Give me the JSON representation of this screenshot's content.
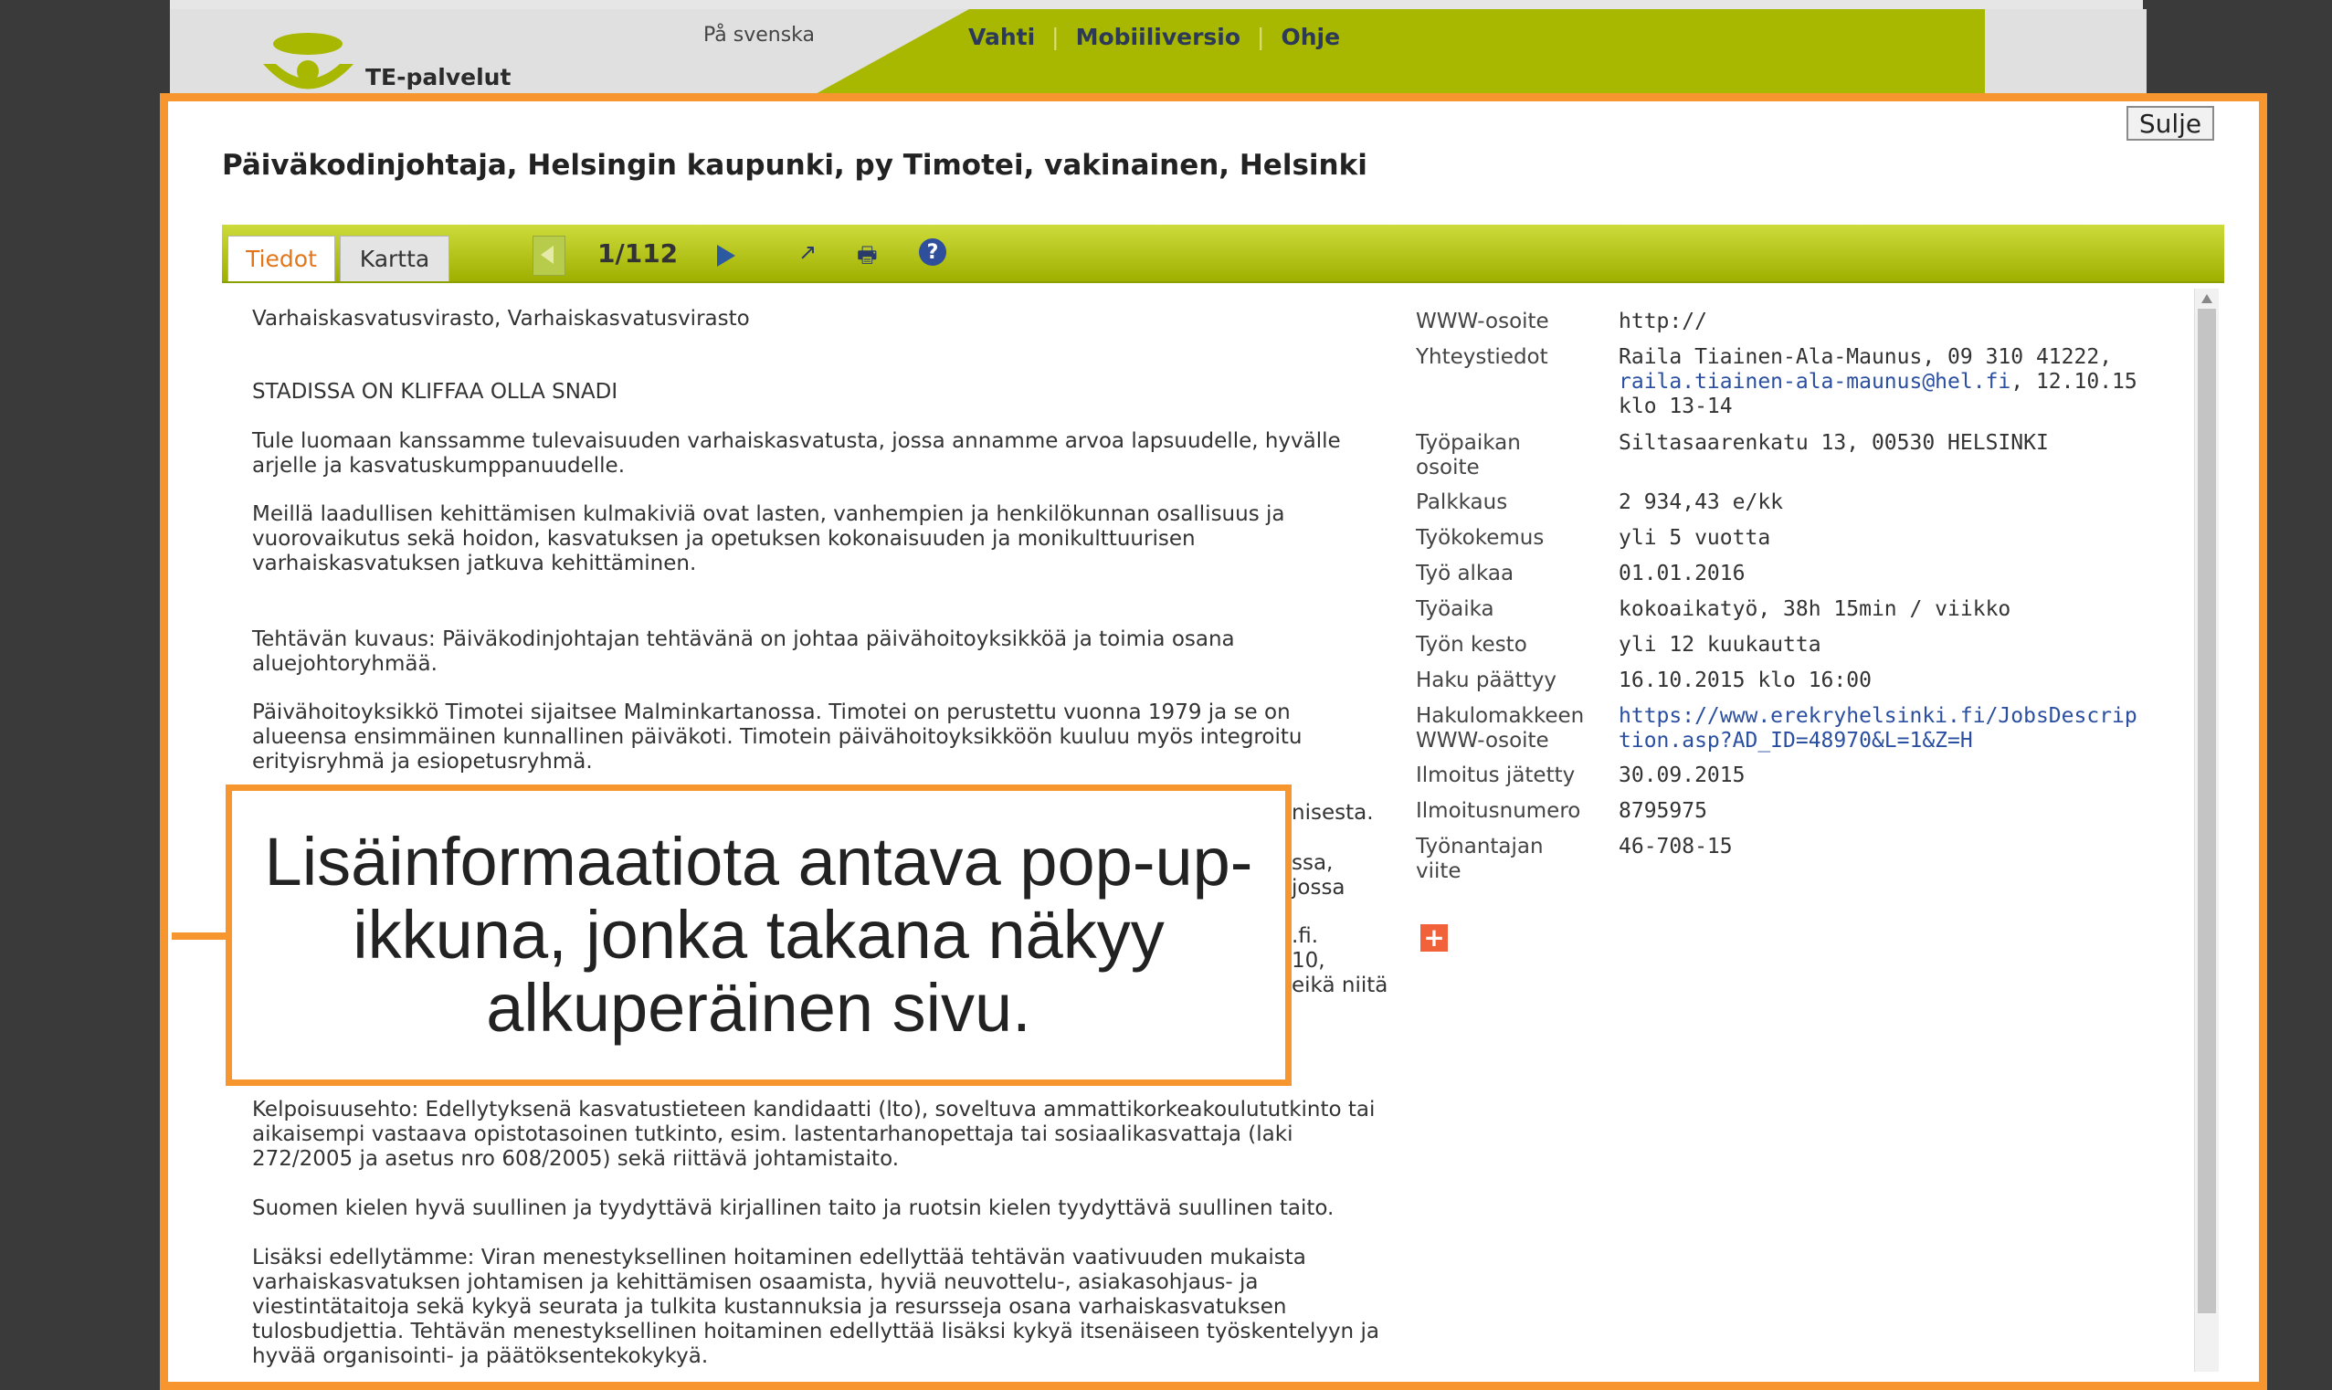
{
  "header": {
    "lang_link": "På svenska",
    "nav": [
      "Vahti",
      "Mobiiliversio",
      "Ohje"
    ],
    "logo_text": "TE-palvelut"
  },
  "popup": {
    "close_label": "Sulje",
    "title": "Päiväkodinjohtaja, Helsingin kaupunki, py Timotei, vakinainen, Helsinki",
    "tabs": [
      "Tiedot",
      "Kartta"
    ],
    "counter": "1/112"
  },
  "content": {
    "employer": "Varhaiskasvatusvirasto, Varhaiskasvatusvirasto",
    "headline": "STADISSA ON KLIFFAA OLLA SNADI",
    "p1": "Tule luomaan kanssamme tulevaisuuden varhaiskasvatusta, jossa annamme arvoa lapsuudelle, hyvälle arjelle ja kasvatuskumppanuudelle.",
    "p2": "Meillä laadullisen kehittämisen kulmakiviä ovat lasten, vanhempien ja henkilökunnan osallisuus ja vuorovaikutus sekä hoidon, kasvatuksen ja opetuksen kokonaisuuden ja monikulttuurisen varhaiskasvatuksen jatkuva kehittäminen.",
    "p3": "Tehtävän kuvaus: Päiväkodinjohtajan tehtävänä on johtaa päivähoitoyksikköä ja toimia osana aluejohtoryhmää.",
    "p4": "Päivähoitoyksikkö Timotei sijaitsee Malminkartanossa. Timotei on perustettu vuonna 1979 ja se on alueensa ensimmäinen kunnallinen päiväkoti. Timotein päivähoitoyksikköön kuuluu myös integroitu erityisryhmä ja esiopetusryhmä.",
    "frag1": "nisesta.",
    "frag2": "ssa, jossa",
    "frag3": ".fi.",
    "frag4": "10,",
    "frag5": "eikä niitä",
    "p5": "Kelpoisuusehto: Edellytyksenä kasvatustieteen kandidaatti (lto), soveltuva ammattikorkeakoulututkinto tai aikaisempi vastaava opistotasoinen tutkinto, esim. lastentarhanopettaja tai sosiaalikasvattaja (laki 272/2005 ja asetus nro 608/2005) sekä riittävä johtamistaito.",
    "p6": "Suomen kielen hyvä suullinen ja tyydyttävä kirjallinen taito ja ruotsin kielen tyydyttävä suullinen taito.",
    "p7": "Lisäksi edellytämme: Viran menestyksellinen hoitaminen edellyttää tehtävän vaativuuden mukaista varhaiskasvatuksen johtamisen ja kehittämisen osaamista, hyviä neuvottelu-, asiakasohjaus- ja viestintätaitoja sekä kykyä seurata ja tulkita kustannuksia ja resursseja osana varhaiskasvatuksen tulosbudjettia. Tehtävän menestyksellinen hoitaminen edellyttää lisäksi kykyä itsenäiseen työskentelyyn ja hyvää organisointi- ja päätöksentekokykyä."
  },
  "details": {
    "www_label": "WWW-osoite",
    "www_value": "http://",
    "contact_label": "Yhteystiedot",
    "contact_value": "Raila Tiainen-Ala-Maunus, 09 310 41222,",
    "contact_email": "raila.tiainen-ala-maunus@hel.fi",
    "contact_rest": ", 12.10.15 klo 13-14",
    "workplace_label": "Työpaikan osoite",
    "workplace_value": "Siltasaarenkatu 13, 00530 HELSINKI",
    "salary_label": "Palkkaus",
    "salary_value": "2 934,43 e/kk",
    "experience_label": "Työkokemus",
    "experience_value": "yli 5 vuotta",
    "start_label": "Työ alkaa",
    "start_value": "01.01.2016",
    "hours_label": "Työaika",
    "hours_value": "kokoaikatyö, 38h 15min / viikko",
    "duration_label": "Työn kesto",
    "duration_value": "yli 12 kuukautta",
    "deadline_label": "Haku päättyy",
    "deadline_value": "16.10.2015 klo 16:00",
    "form_label": "Hakulomakkeen WWW-osoite",
    "form_value": "https://www.erekryhelsinki.fi/JobsDescription.asp?AD_ID=48970&L=1&Z=H",
    "posted_label": "Ilmoitus jätetty",
    "posted_value": "30.09.2015",
    "number_label": "Ilmoitusnumero",
    "number_value": "8795975",
    "ref_label": "Työnantajan viite",
    "ref_value": "46-708-15"
  },
  "callout": {
    "text": "Lisäinformaatiota antava pop-up-ikkuna, jonka takana näkyy alkuperäinen sivu."
  },
  "colors": {
    "accent": "#f7952f",
    "toolbar": "#a8b700",
    "link": "#2b4fa0"
  }
}
